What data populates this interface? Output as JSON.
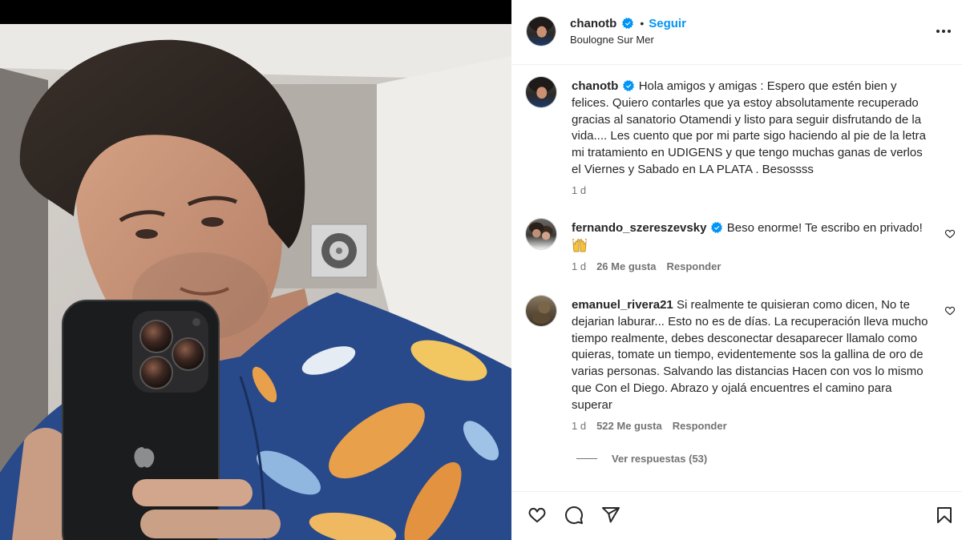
{
  "post": {
    "author": {
      "username": "chanotb",
      "verified": true,
      "separator": "•",
      "follow_label": "Seguir",
      "location": "Boulogne Sur Mer"
    },
    "more_icon": "more-horizontal-icon",
    "caption": {
      "username": "chanotb",
      "verified": true,
      "text": "Hola amigos y amigas : Espero que estén bien y felices. Quiero contarles que ya estoy absolutamente recuperado gracias al sanatorio Otamendi y listo para seguir disfrutando de la vida.... Les cuento que por mi parte sigo haciendo al pie de la letra mi tratamiento en UDIGENS y que tengo muchas ganas de verlos el Viernes y Sabado en LA PLATA . Besossss",
      "time": "1 d"
    },
    "comments": [
      {
        "username": "fernando_szereszevsky",
        "verified": true,
        "text": "Beso enorme! Te escribo en privado!",
        "emoji_icon": "raising-hands-emoji",
        "time": "1 d",
        "likes": "26 Me gusta",
        "reply_label": "Responder",
        "like_icon": "heart-outline-icon"
      },
      {
        "username": "emanuel_rivera21",
        "verified": false,
        "text": "Si realmente te quisieran como dicen, No te dejarian laburar... Esto no es de días. La recuperación lleva mucho tiempo realmente, debes desconectar desaparecer llamalo como quieras, tomate un tiempo, evidentemente sos la gallina de oro de varias personas. Salvando las distancias Hacen con vos lo mismo que Con el Diego. Abrazo y ojalá encuentres el camino para superar",
        "time": "1 d",
        "likes": "522 Me gusta",
        "reply_label": "Responder",
        "like_icon": "heart-outline-icon"
      }
    ],
    "view_replies": "Ver respuestas (53)",
    "actions": [
      "heart-icon",
      "comment-icon",
      "share-icon",
      "bookmark-icon"
    ]
  },
  "colors": {
    "accent": "#0095f6",
    "text": "#262626",
    "secondary": "#737373",
    "divider": "#efefef",
    "verified": "#0095f6"
  }
}
